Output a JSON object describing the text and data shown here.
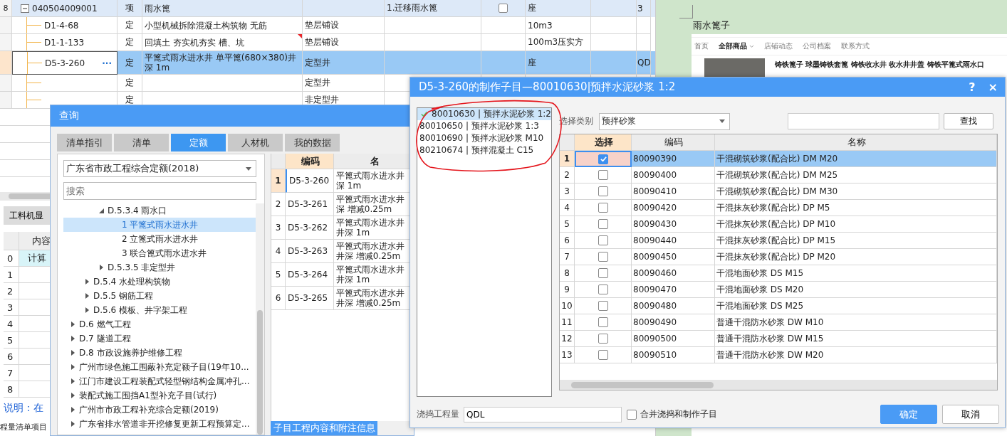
{
  "sheet": {
    "rows": [
      {
        "kind": "list_item",
        "row_number": "8",
        "code": "040504009001",
        "expanded": true,
        "type": "项",
        "name": "雨水篦",
        "column_5": "1.迁移雨水篦",
        "checked": false,
        "unit": "座",
        "column_9": "3",
        "selected": false,
        "note": false
      },
      {
        "kind": "quota",
        "code": "D1-4-68",
        "type": "定",
        "name": "小型机械拆除混凝土构筑物 无筋",
        "column_4": "垫层铺设",
        "unit": "10m3",
        "selected": false,
        "note": false
      },
      {
        "kind": "quota",
        "code": "D1-1-133",
        "type": "定",
        "name": "回填土 夯实机夯实 槽、坑",
        "column_4": "垫层铺设",
        "unit": "100m3压实方",
        "selected": false,
        "note": true
      },
      {
        "kind": "quota",
        "code": "D5-3-260",
        "more": "···",
        "type": "定",
        "name": "平篦式雨水进水井 单平篦(680×380)井深 1m",
        "column_4": "定型井",
        "unit": "座",
        "column_9": "QD",
        "selected": true,
        "note": false
      },
      {
        "kind": "quota",
        "type": "定",
        "column_4": "定型井",
        "selected": false,
        "note": false
      },
      {
        "kind": "quota",
        "type": "定",
        "column_4": "非定型井",
        "selected": false,
        "note": false
      }
    ],
    "bottom_tab": "工料机显",
    "detail_table": {
      "header": "内容",
      "rows": [
        {
          "number": "0",
          "content": "计算",
          "selected": true
        },
        {
          "number": "1",
          "selected": false
        },
        {
          "number": "2",
          "selected": false
        },
        {
          "number": "3",
          "selected": false
        },
        {
          "number": "4",
          "selected": false
        },
        {
          "number": "5",
          "selected": false
        },
        {
          "number": "6",
          "selected": false
        },
        {
          "number": "7",
          "selected": false
        },
        {
          "number": "8",
          "selected": false
        }
      ]
    },
    "explanation": "说明：在",
    "footer_text": "程量清单项目"
  },
  "document": {
    "paragraph": "雨水篦子",
    "web_page": {
      "nav": [
        {
          "label": "首页",
          "selected": false
        },
        {
          "label": "全部商品",
          "selected": true
        },
        {
          "label": "店铺动态",
          "selected": false
        },
        {
          "label": "公司档案",
          "selected": false
        },
        {
          "label": "联系方式",
          "selected": false
        }
      ],
      "product_title": "铸铁篦子 球墨铸铁套篦 铸铁收水井 收水井井盖 铸铁平篦式雨水口"
    }
  },
  "query_dialog": {
    "title": "查询",
    "tabs": [
      {
        "label": "清单指引",
        "selected": false
      },
      {
        "label": "清单",
        "selected": false
      },
      {
        "label": "定额",
        "selected": true
      },
      {
        "label": "人材机",
        "selected": false
      },
      {
        "label": "我的数据",
        "selected": false
      }
    ],
    "library": "广东省市政工程综合定额(2018)",
    "search_placeholder": "搜索",
    "tree": [
      {
        "children": [
          {
            "children": [
              {
                "label": "D.5.3.4 雨水口",
                "expanded": true,
                "selected": false,
                "children": [
                  {
                    "label": "1 平篦式雨水进水井",
                    "selected": true
                  },
                  {
                    "label": "2 立篦式雨水进水井",
                    "selected": false
                  },
                  {
                    "label": "3 联合篦式雨水进水井",
                    "selected": false
                  }
                ]
              },
              {
                "label": "D.5.3.5 非定型井",
                "expanded": false,
                "selected": false
              }
            ]
          },
          {
            "label": "D.5.4 水处理构筑物",
            "expanded": false,
            "selected": false
          },
          {
            "label": "D.5.5 钢筋工程",
            "expanded": false,
            "selected": false
          },
          {
            "label": "D.5.6 模板、井字架工程",
            "expanded": false,
            "selected": false
          }
        ]
      },
      {
        "label": "D.6 燃气工程",
        "expanded": false,
        "selected": false
      },
      {
        "label": "D.7 隧道工程",
        "expanded": false,
        "selected": false
      },
      {
        "label": "D.8 市政设施养护维修工程",
        "expanded": false,
        "selected": false
      },
      {
        "label": "广州市绿色施工围蔽补充定额子目(19年10...",
        "expanded": false,
        "selected": false
      },
      {
        "label": "江门市建设工程装配式轻型钢结构金属冲孔...",
        "expanded": false,
        "selected": false
      },
      {
        "label": "装配式施工围挡A1型补充子目(试行)",
        "expanded": false,
        "selected": false
      },
      {
        "label": "广州市市政工程补充综合定额(2019)",
        "expanded": false,
        "selected": false
      },
      {
        "label": "广东省排水管道非开挖修复更新工程预算定...",
        "expanded": false,
        "selected": false
      }
    ],
    "table": {
      "columns": [
        "编码",
        "名"
      ],
      "rows": [
        {
          "number": "1",
          "code": "D5-3-260",
          "name": "平篦式雨水进水井深 1m",
          "selected": true
        },
        {
          "number": "2",
          "code": "D5-3-261",
          "name": "平篦式雨水进水井深 增减0.25m",
          "selected": false
        },
        {
          "number": "3",
          "code": "D5-3-262",
          "name": "平篦式雨水进水井井深 1m",
          "selected": false
        },
        {
          "number": "4",
          "code": "D5-3-263",
          "name": "平篦式雨水进水井井深 增减0.25m",
          "selected": false
        },
        {
          "number": "5",
          "code": "D5-3-264",
          "name": "平篦式雨水进水井井深 1m",
          "selected": false
        },
        {
          "number": "6",
          "code": "D5-3-265",
          "name": "平篦式雨水进水井井深 增减0.25m",
          "selected": false
        }
      ]
    },
    "bottom_button": "子目工程内容和附注信息"
  },
  "material_dialog": {
    "title": "D5-3-260的制作子目—80010630|预拌水泥砂浆 1:2",
    "help": "?",
    "close": "×",
    "items": [
      {
        "label": "80010630 | 预拌水泥砂浆 1:2",
        "selected": true
      },
      {
        "label": "80010650 | 预拌水泥砂浆 1:3",
        "selected": false
      },
      {
        "label": "80010690 | 预拌水泥砂浆 M10",
        "selected": false
      },
      {
        "label": "80210674 | 预拌混凝土 C15",
        "selected": false
      }
    ],
    "category_label": "选择类别",
    "category": "预拌砂浆",
    "search_button": "查找",
    "table": {
      "columns": [
        "选择",
        "编码",
        "名称"
      ],
      "rows": [
        {
          "number": "1",
          "checked": true,
          "code": "80090390",
          "name": "干混砌筑砂浆(配合比) DM M20",
          "selected": true
        },
        {
          "number": "2",
          "checked": false,
          "code": "80090400",
          "name": "干混砌筑砂浆(配合比) DM M25",
          "selected": false
        },
        {
          "number": "3",
          "checked": false,
          "code": "80090410",
          "name": "干混砌筑砂浆(配合比) DM M30",
          "selected": false
        },
        {
          "number": "4",
          "checked": false,
          "code": "80090420",
          "name": "干混抹灰砂浆(配合比) DP M5",
          "selected": false
        },
        {
          "number": "5",
          "checked": false,
          "code": "80090430",
          "name": "干混抹灰砂浆(配合比) DP M10",
          "selected": false
        },
        {
          "number": "6",
          "checked": false,
          "code": "80090440",
          "name": "干混抹灰砂浆(配合比) DP M15",
          "selected": false
        },
        {
          "number": "7",
          "checked": false,
          "code": "80090450",
          "name": "干混抹灰砂浆(配合比) DP M20",
          "selected": false
        },
        {
          "number": "8",
          "checked": false,
          "code": "80090460",
          "name": "干混地面砂浆 DS M15",
          "selected": false
        },
        {
          "number": "9",
          "checked": false,
          "code": "80090470",
          "name": "干混地面砂浆 DS M20",
          "selected": false
        },
        {
          "number": "10",
          "checked": false,
          "code": "80090480",
          "name": "干混地面砂浆 DS M25",
          "selected": false
        },
        {
          "number": "11",
          "checked": false,
          "code": "80090490",
          "name": "普通干混防水砂浆 DW M10",
          "selected": false
        },
        {
          "number": "12",
          "checked": false,
          "code": "80090500",
          "name": "普通干混防水砂浆 DW M15",
          "selected": false
        },
        {
          "number": "13",
          "checked": false,
          "code": "80090510",
          "name": "普通干混防水砂浆 DW M20",
          "selected": false
        }
      ]
    },
    "quantity_label": "浇捣工程量",
    "quantity": "QDL",
    "merge": {
      "label": "合并浇捣和制作子目",
      "checked": false
    },
    "buttons": [
      {
        "label": "确定",
        "kind": "primary"
      },
      {
        "label": "取消",
        "kind": "secondary"
      }
    ]
  }
}
